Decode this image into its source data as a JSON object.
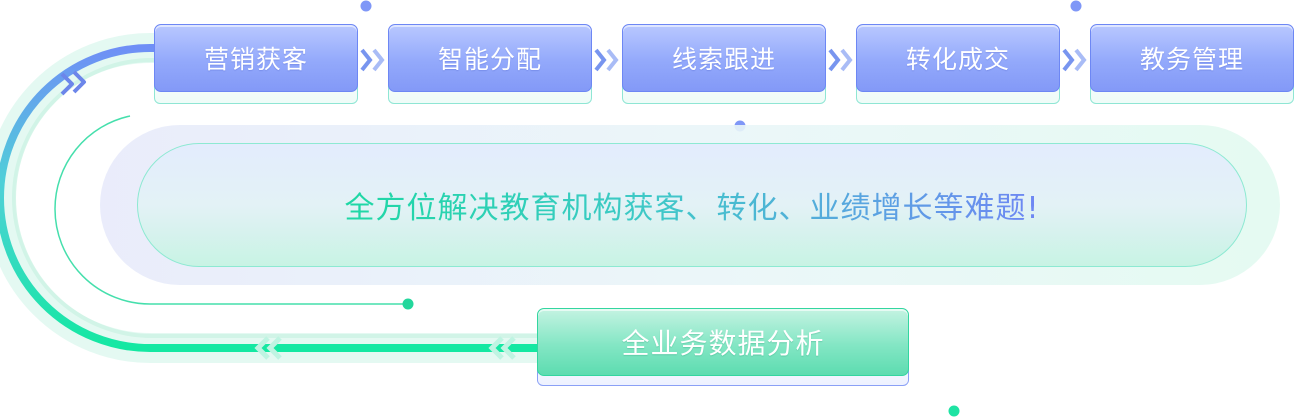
{
  "steps": [
    {
      "label": "营销获客"
    },
    {
      "label": "智能分配"
    },
    {
      "label": "线索跟进"
    },
    {
      "label": "转化成交"
    },
    {
      "label": "教务管理"
    }
  ],
  "banner": {
    "text": "全方位解决教育机构获客、转化、业绩增长等难题!"
  },
  "analysis": {
    "label": "全业务数据分析"
  },
  "colors": {
    "blue": "#7f97f7",
    "green": "#1ee8a6",
    "banner_text_start": "#1ed8a4",
    "banner_text_end": "#6f86f4"
  },
  "icons": [
    "double-chevron-right-icon",
    "double-chevron-left-icon",
    "dot-marker-icon"
  ]
}
